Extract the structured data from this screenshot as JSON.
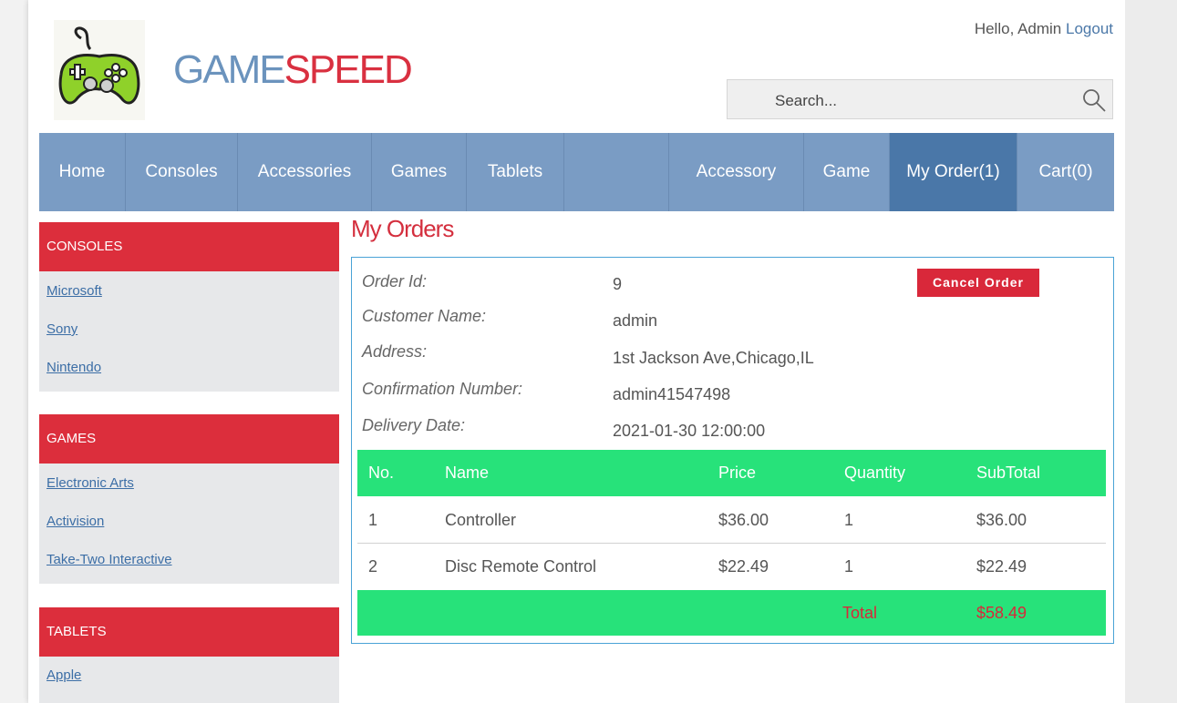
{
  "header": {
    "brand_part1": "GAME",
    "brand_part2": "SPEED",
    "greeting": "Hello, Admin",
    "logout_label": "Logout",
    "search_placeholder": "Search..."
  },
  "nav": {
    "items": [
      {
        "label": "Home"
      },
      {
        "label": "Consoles"
      },
      {
        "label": "Accessories"
      },
      {
        "label": "Games"
      },
      {
        "label": "Tablets"
      },
      {
        "label": "Accessory"
      },
      {
        "label": "Game"
      },
      {
        "label": "My Order(1)"
      },
      {
        "label": "Cart(0)"
      }
    ],
    "active": "My Order(1)"
  },
  "sidebar": {
    "sections": [
      {
        "title": "CONSOLES",
        "links": [
          "Microsoft",
          "Sony",
          "Nintendo"
        ]
      },
      {
        "title": "GAMES",
        "links": [
          "Electronic Arts",
          "Activision",
          "Take-Two Interactive"
        ]
      },
      {
        "title": "TABLETS",
        "links": [
          "Apple"
        ]
      }
    ]
  },
  "main": {
    "title": "My Orders",
    "cancel_label": "Cancel Order",
    "details": [
      {
        "label": "Order Id:",
        "value": "9"
      },
      {
        "label": "Customer Name:",
        "value": "admin"
      },
      {
        "label": "Address:",
        "value": "1st Jackson Ave,Chicago,IL"
      },
      {
        "label": "Confirmation Number:",
        "value": "admin41547498"
      },
      {
        "label": "Delivery Date:",
        "value": "2021-01-30 12:00:00"
      }
    ],
    "table": {
      "headers": [
        "No.",
        "Name",
        "Price",
        "Quantity",
        "SubTotal"
      ],
      "rows": [
        [
          "1",
          "Controller",
          "$36.00",
          "1",
          "$36.00"
        ],
        [
          "2",
          "Disc Remote Control",
          "$22.49",
          "1",
          "$22.49"
        ]
      ],
      "total_label": "Total",
      "total_value": "$58.49"
    }
  },
  "colors": {
    "nav": "#7a9cc4",
    "nav_active": "#4a77a8",
    "accent_red": "#dc2e3c",
    "table_green": "#27e27a"
  }
}
